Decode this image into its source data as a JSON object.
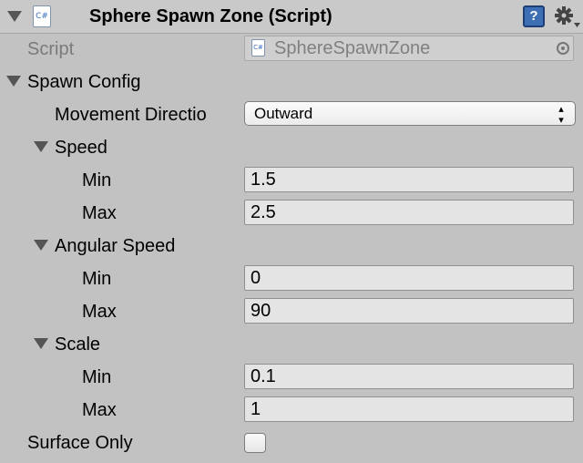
{
  "header": {
    "title": "Sphere Spawn Zone (Script)",
    "csharp_icon_text": "C#",
    "help_icon_text": "?",
    "gear_icon": "gear-icon"
  },
  "script_row": {
    "label": "Script",
    "value": "SphereSpawnZone",
    "picker_icon": "object-picker-icon"
  },
  "spawn_config": {
    "label": "Spawn Config",
    "movement_direction": {
      "label": "Movement Directio",
      "value": "Outward",
      "arrows": "▴▾"
    },
    "speed": {
      "label": "Speed",
      "min_label": "Min",
      "min_value": "1.5",
      "max_label": "Max",
      "max_value": "2.5"
    },
    "angular_speed": {
      "label": "Angular Speed",
      "min_label": "Min",
      "min_value": "0",
      "max_label": "Max",
      "max_value": "90"
    },
    "scale": {
      "label": "Scale",
      "min_label": "Min",
      "min_value": "0.1",
      "max_label": "Max",
      "max_value": "1"
    }
  },
  "surface_only": {
    "label": "Surface Only",
    "checked": false
  }
}
